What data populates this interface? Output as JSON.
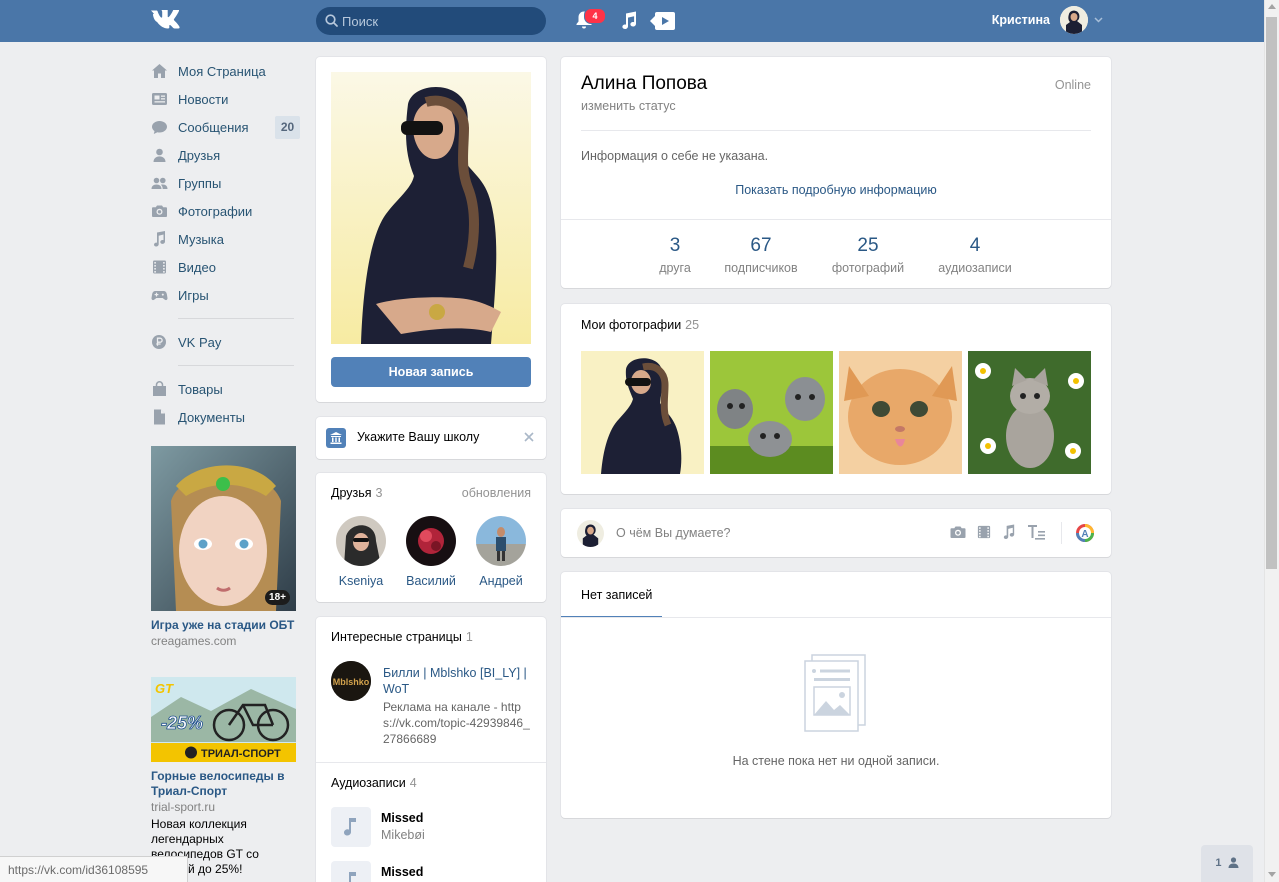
{
  "header": {
    "logo": "VK",
    "search_placeholder": "Поиск",
    "notifications_count": "4",
    "user_name": "Кристина"
  },
  "nav": {
    "items": [
      {
        "label": "Моя Страница",
        "icon": "home-icon"
      },
      {
        "label": "Новости",
        "icon": "news-icon"
      },
      {
        "label": "Сообщения",
        "icon": "messages-icon",
        "count": "20"
      },
      {
        "label": "Друзья",
        "icon": "friends-icon"
      },
      {
        "label": "Группы",
        "icon": "groups-icon"
      },
      {
        "label": "Фотографии",
        "icon": "camera-icon"
      },
      {
        "label": "Музыка",
        "icon": "music-icon"
      },
      {
        "label": "Видео",
        "icon": "video-icon"
      },
      {
        "label": "Игры",
        "icon": "gamepad-icon"
      }
    ],
    "vkpay": "VK Pay",
    "extra": [
      {
        "label": "Товары",
        "icon": "bag-icon"
      },
      {
        "label": "Документы",
        "icon": "document-icon"
      }
    ]
  },
  "ads": [
    {
      "title": "Игра уже на стадии ОБТ",
      "domain": "creagames.com",
      "age": "18+"
    },
    {
      "title": "Горные велосипеды в Триал-Спорт",
      "domain": "trial-sport.ru",
      "text": "Новая коллекция легендарных велосипедов GT со скидкой до 25%!",
      "banner_brand": "GT",
      "banner_discount": "-25%",
      "banner_shop": "ТРИАЛ-СПОРТ"
    }
  ],
  "profile": {
    "new_post_button": "Новая запись",
    "school_prompt": "Укажите Вашу школу",
    "name": "Алина Попова",
    "status_link": "изменить статус",
    "online": "Online",
    "about": "Информация о себе не указана.",
    "show_more": "Показать подробную информацию",
    "counters": [
      {
        "value": "3",
        "label": "друга"
      },
      {
        "value": "67",
        "label": "подписчиков"
      },
      {
        "value": "25",
        "label": "фотографий"
      },
      {
        "value": "4",
        "label": "аудиозаписи"
      }
    ]
  },
  "friends": {
    "title": "Друзья",
    "count": "3",
    "updates": "обновления",
    "list": [
      {
        "name": "Kseniya"
      },
      {
        "name": "Василий"
      },
      {
        "name": "Андрей"
      }
    ]
  },
  "pages": {
    "title": "Интересные страницы",
    "count": "1",
    "item_name": "Билли | Mblshko [BI_LY] | WoT",
    "item_desc": "Реклама на канале - https://vk.com/topic-42939846_27866689",
    "avatar_text": "Mblshko"
  },
  "audio": {
    "title": "Аудиозаписи",
    "count": "4",
    "tracks": [
      {
        "title": "Missed",
        "artist": "Mikebøi"
      },
      {
        "title": "Missed",
        "artist": ""
      }
    ]
  },
  "photos": {
    "title": "Мои фотографии",
    "count": "25"
  },
  "composer": {
    "placeholder": "О чём Вы думаете?"
  },
  "wall": {
    "tab": "Нет записей",
    "empty": "На стене пока нет ни одной записи."
  },
  "status_bar_url": "https://vk.com/id36108595",
  "online_users": "1",
  "colors": {
    "header": "#4a76a8",
    "button": "#5181b8",
    "link": "#2a5885",
    "badge": "#ff3347"
  }
}
